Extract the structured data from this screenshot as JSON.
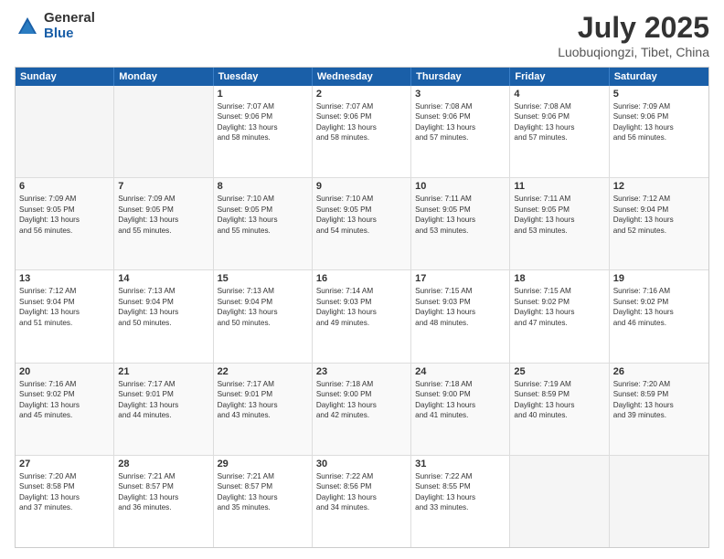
{
  "logo": {
    "general": "General",
    "blue": "Blue"
  },
  "title": "July 2025",
  "subtitle": "Luobuqiongzi, Tibet, China",
  "header_days": [
    "Sunday",
    "Monday",
    "Tuesday",
    "Wednesday",
    "Thursday",
    "Friday",
    "Saturday"
  ],
  "weeks": [
    {
      "cells": [
        {
          "empty": true
        },
        {
          "empty": true
        },
        {
          "day": "1",
          "lines": [
            "Sunrise: 7:07 AM",
            "Sunset: 9:06 PM",
            "Daylight: 13 hours",
            "and 58 minutes."
          ]
        },
        {
          "day": "2",
          "lines": [
            "Sunrise: 7:07 AM",
            "Sunset: 9:06 PM",
            "Daylight: 13 hours",
            "and 58 minutes."
          ]
        },
        {
          "day": "3",
          "lines": [
            "Sunrise: 7:08 AM",
            "Sunset: 9:06 PM",
            "Daylight: 13 hours",
            "and 57 minutes."
          ]
        },
        {
          "day": "4",
          "lines": [
            "Sunrise: 7:08 AM",
            "Sunset: 9:06 PM",
            "Daylight: 13 hours",
            "and 57 minutes."
          ]
        },
        {
          "day": "5",
          "lines": [
            "Sunrise: 7:09 AM",
            "Sunset: 9:06 PM",
            "Daylight: 13 hours",
            "and 56 minutes."
          ]
        }
      ]
    },
    {
      "shaded": true,
      "cells": [
        {
          "day": "6",
          "lines": [
            "Sunrise: 7:09 AM",
            "Sunset: 9:05 PM",
            "Daylight: 13 hours",
            "and 56 minutes."
          ]
        },
        {
          "day": "7",
          "lines": [
            "Sunrise: 7:09 AM",
            "Sunset: 9:05 PM",
            "Daylight: 13 hours",
            "and 55 minutes."
          ]
        },
        {
          "day": "8",
          "lines": [
            "Sunrise: 7:10 AM",
            "Sunset: 9:05 PM",
            "Daylight: 13 hours",
            "and 55 minutes."
          ]
        },
        {
          "day": "9",
          "lines": [
            "Sunrise: 7:10 AM",
            "Sunset: 9:05 PM",
            "Daylight: 13 hours",
            "and 54 minutes."
          ]
        },
        {
          "day": "10",
          "lines": [
            "Sunrise: 7:11 AM",
            "Sunset: 9:05 PM",
            "Daylight: 13 hours",
            "and 53 minutes."
          ]
        },
        {
          "day": "11",
          "lines": [
            "Sunrise: 7:11 AM",
            "Sunset: 9:05 PM",
            "Daylight: 13 hours",
            "and 53 minutes."
          ]
        },
        {
          "day": "12",
          "lines": [
            "Sunrise: 7:12 AM",
            "Sunset: 9:04 PM",
            "Daylight: 13 hours",
            "and 52 minutes."
          ]
        }
      ]
    },
    {
      "cells": [
        {
          "day": "13",
          "lines": [
            "Sunrise: 7:12 AM",
            "Sunset: 9:04 PM",
            "Daylight: 13 hours",
            "and 51 minutes."
          ]
        },
        {
          "day": "14",
          "lines": [
            "Sunrise: 7:13 AM",
            "Sunset: 9:04 PM",
            "Daylight: 13 hours",
            "and 50 minutes."
          ]
        },
        {
          "day": "15",
          "lines": [
            "Sunrise: 7:13 AM",
            "Sunset: 9:04 PM",
            "Daylight: 13 hours",
            "and 50 minutes."
          ]
        },
        {
          "day": "16",
          "lines": [
            "Sunrise: 7:14 AM",
            "Sunset: 9:03 PM",
            "Daylight: 13 hours",
            "and 49 minutes."
          ]
        },
        {
          "day": "17",
          "lines": [
            "Sunrise: 7:15 AM",
            "Sunset: 9:03 PM",
            "Daylight: 13 hours",
            "and 48 minutes."
          ]
        },
        {
          "day": "18",
          "lines": [
            "Sunrise: 7:15 AM",
            "Sunset: 9:02 PM",
            "Daylight: 13 hours",
            "and 47 minutes."
          ]
        },
        {
          "day": "19",
          "lines": [
            "Sunrise: 7:16 AM",
            "Sunset: 9:02 PM",
            "Daylight: 13 hours",
            "and 46 minutes."
          ]
        }
      ]
    },
    {
      "shaded": true,
      "cells": [
        {
          "day": "20",
          "lines": [
            "Sunrise: 7:16 AM",
            "Sunset: 9:02 PM",
            "Daylight: 13 hours",
            "and 45 minutes."
          ]
        },
        {
          "day": "21",
          "lines": [
            "Sunrise: 7:17 AM",
            "Sunset: 9:01 PM",
            "Daylight: 13 hours",
            "and 44 minutes."
          ]
        },
        {
          "day": "22",
          "lines": [
            "Sunrise: 7:17 AM",
            "Sunset: 9:01 PM",
            "Daylight: 13 hours",
            "and 43 minutes."
          ]
        },
        {
          "day": "23",
          "lines": [
            "Sunrise: 7:18 AM",
            "Sunset: 9:00 PM",
            "Daylight: 13 hours",
            "and 42 minutes."
          ]
        },
        {
          "day": "24",
          "lines": [
            "Sunrise: 7:18 AM",
            "Sunset: 9:00 PM",
            "Daylight: 13 hours",
            "and 41 minutes."
          ]
        },
        {
          "day": "25",
          "lines": [
            "Sunrise: 7:19 AM",
            "Sunset: 8:59 PM",
            "Daylight: 13 hours",
            "and 40 minutes."
          ]
        },
        {
          "day": "26",
          "lines": [
            "Sunrise: 7:20 AM",
            "Sunset: 8:59 PM",
            "Daylight: 13 hours",
            "and 39 minutes."
          ]
        }
      ]
    },
    {
      "cells": [
        {
          "day": "27",
          "lines": [
            "Sunrise: 7:20 AM",
            "Sunset: 8:58 PM",
            "Daylight: 13 hours",
            "and 37 minutes."
          ]
        },
        {
          "day": "28",
          "lines": [
            "Sunrise: 7:21 AM",
            "Sunset: 8:57 PM",
            "Daylight: 13 hours",
            "and 36 minutes."
          ]
        },
        {
          "day": "29",
          "lines": [
            "Sunrise: 7:21 AM",
            "Sunset: 8:57 PM",
            "Daylight: 13 hours",
            "and 35 minutes."
          ]
        },
        {
          "day": "30",
          "lines": [
            "Sunrise: 7:22 AM",
            "Sunset: 8:56 PM",
            "Daylight: 13 hours",
            "and 34 minutes."
          ]
        },
        {
          "day": "31",
          "lines": [
            "Sunrise: 7:22 AM",
            "Sunset: 8:55 PM",
            "Daylight: 13 hours",
            "and 33 minutes."
          ]
        },
        {
          "empty": true
        },
        {
          "empty": true
        }
      ]
    }
  ]
}
